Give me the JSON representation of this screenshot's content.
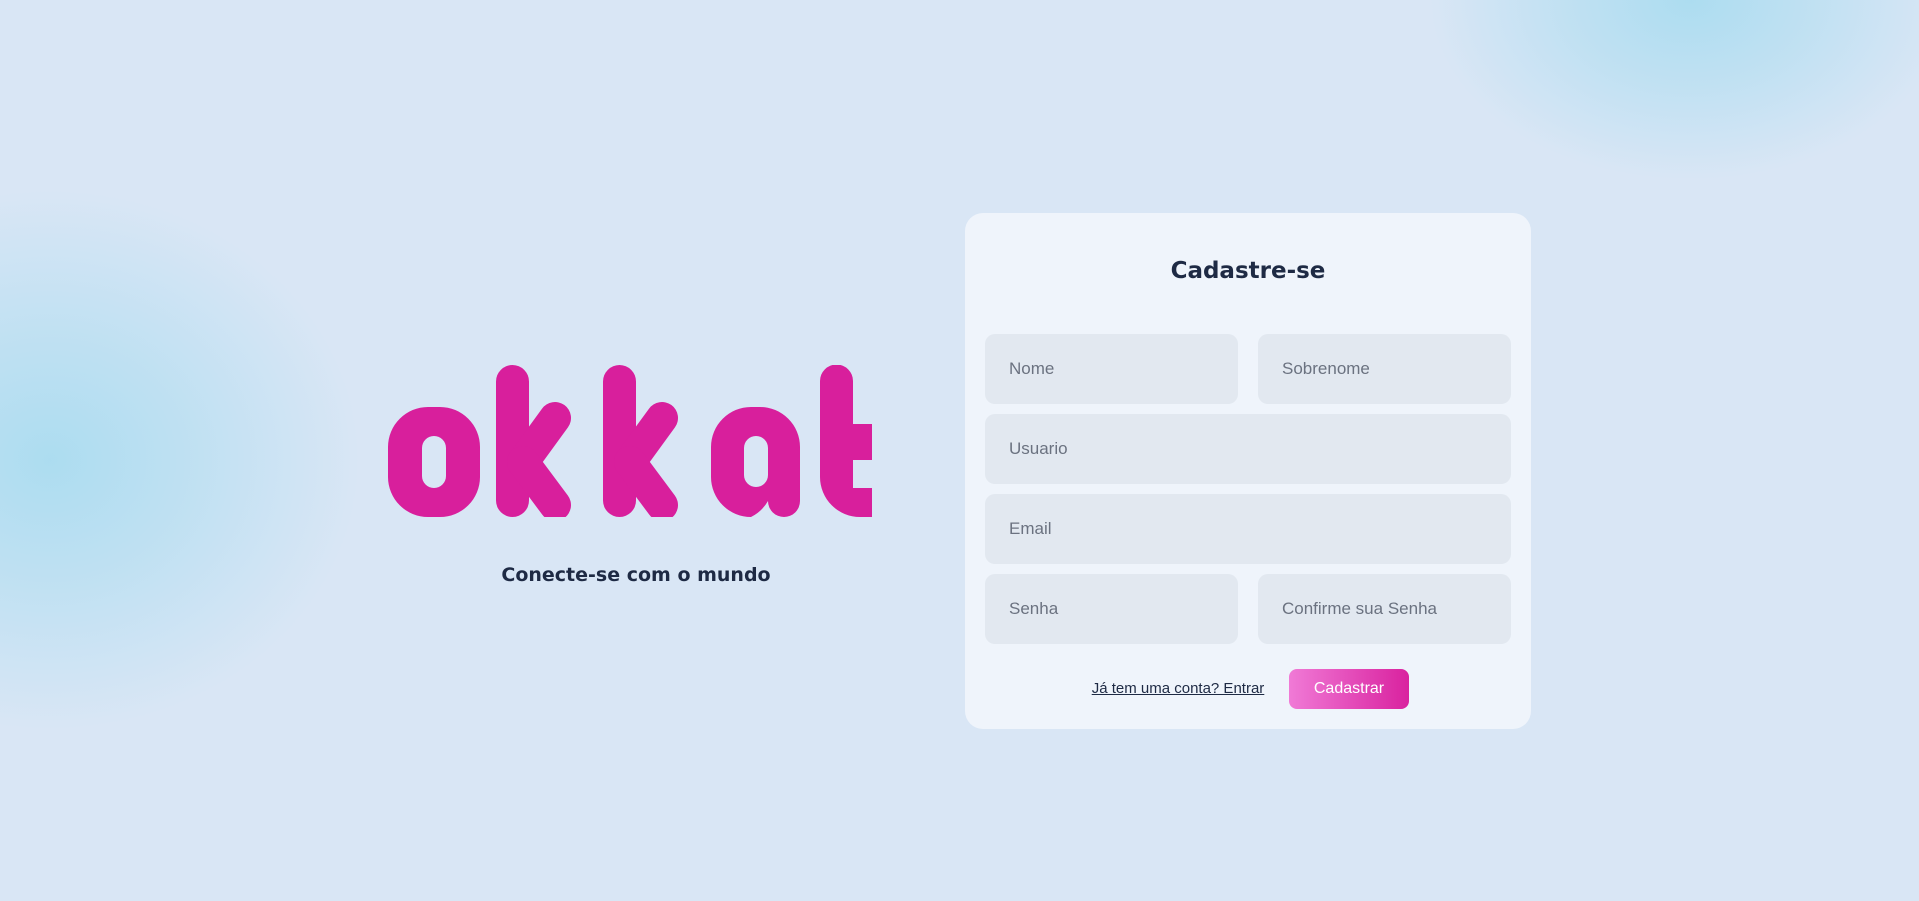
{
  "brand": {
    "logo_text": "okkat",
    "tagline": "Conecte-se com o mundo",
    "color": "#d81f9c"
  },
  "signup": {
    "title": "Cadastre-se",
    "fields": {
      "first_name": "Nome",
      "last_name": "Sobrenome",
      "username": "Usuario",
      "email": "Email",
      "password": "Senha",
      "confirm_password": "Confirme sua Senha"
    },
    "login_link": "Já tem uma conta? Entrar",
    "submit_label": "Cadastrar"
  },
  "colors": {
    "background": "#d9e6f5",
    "card": "#eff4fb",
    "input": "#e2e8f0",
    "accent": "#d81f9c",
    "text": "#1e2a44"
  }
}
